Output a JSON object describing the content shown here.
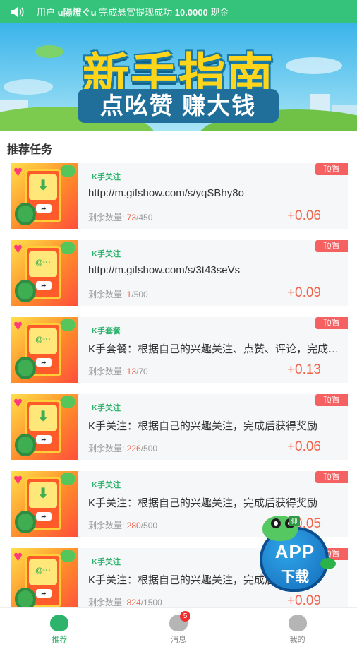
{
  "notice": {
    "prefix": "用户",
    "user": "u陽燈ぐu",
    "middle": "完成悬赏提现成功",
    "amount": "10.0000",
    "suffix": "现金"
  },
  "banner": {
    "title": "新手指南",
    "subtitle": "点吆赞 赚大钱"
  },
  "section_title": "推荐任务",
  "tasks": [
    {
      "tag": "K手关注",
      "title": "http://m.gifshow.com/s/yqSBhy8o",
      "remain_label": "剩余数量: ",
      "remain": "73",
      "total": "/450",
      "reward": "+0.06",
      "pin": "顶置",
      "glyph": "⬇"
    },
    {
      "tag": "K手关注",
      "title": "http://m.gifshow.com/s/3t43seVs",
      "remain_label": "剩余数量: ",
      "remain": "1",
      "total": "/500",
      "reward": "+0.09",
      "pin": "顶置",
      "glyph": "@···"
    },
    {
      "tag": "K手套餐",
      "title": "K手套餐：根据自己的兴趣关注、点赞、评论，完成后获得奖励",
      "remain_label": "剩余数量: ",
      "remain": "13",
      "total": "/70",
      "reward": "+0.13",
      "pin": "顶置",
      "glyph": "@···"
    },
    {
      "tag": "K手关注",
      "title": "K手关注：根据自己的兴趣关注，完成后获得奖励",
      "remain_label": "剩余数量: ",
      "remain": "226",
      "total": "/500",
      "reward": "+0.06",
      "pin": "顶置",
      "glyph": "⬇"
    },
    {
      "tag": "K手关注",
      "title": "K手关注：根据自己的兴趣关注，完成后获得奖励",
      "remain_label": "剩余数量: ",
      "remain": "280",
      "total": "/500",
      "reward": "+0.05",
      "pin": "顶置",
      "glyph": "⬇"
    },
    {
      "tag": "K手关注",
      "title": "K手关注：根据自己的兴趣关注，完成后获得奖励",
      "remain_label": "剩余数量: ",
      "remain": "824",
      "total": "/1500",
      "reward": "+0.09",
      "pin": "顶置",
      "glyph": "@···"
    }
  ],
  "fab": {
    "line1": "APP",
    "line2": "下载",
    "sign": "仰"
  },
  "tabbar": [
    {
      "label": "推荐",
      "icon": "frog-recommend-icon",
      "active": true,
      "color": "#2db36b"
    },
    {
      "label": "消息",
      "icon": "message-icon",
      "badge": "5",
      "color": "#888888"
    },
    {
      "label": "我的",
      "icon": "frog-profile-icon",
      "color": "#888888"
    }
  ],
  "colors": {
    "primary": "#35c27a",
    "reward": "#f0644a",
    "pin": "#f56061"
  }
}
